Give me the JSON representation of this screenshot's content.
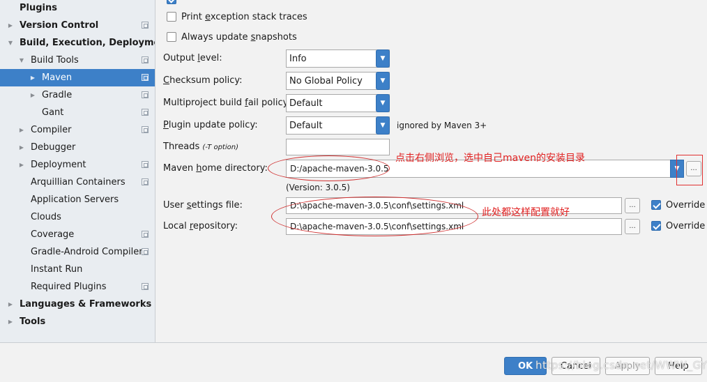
{
  "sidebar": {
    "items": [
      {
        "label": "Plugins",
        "bold": true,
        "level": 0,
        "arrow": "none",
        "icon": false,
        "selected": false
      },
      {
        "label": "Version Control",
        "bold": true,
        "level": 0,
        "arrow": "right",
        "icon": true,
        "selected": false
      },
      {
        "label": "Build, Execution, Deployment",
        "bold": true,
        "level": 0,
        "arrow": "down",
        "icon": false,
        "selected": false
      },
      {
        "label": "Build Tools",
        "bold": false,
        "level": 1,
        "arrow": "down",
        "icon": true,
        "selected": false
      },
      {
        "label": "Maven",
        "bold": false,
        "level": 2,
        "arrow": "right",
        "icon": true,
        "selected": true
      },
      {
        "label": "Gradle",
        "bold": false,
        "level": 2,
        "arrow": "right",
        "icon": true,
        "selected": false
      },
      {
        "label": "Gant",
        "bold": false,
        "level": 2,
        "arrow": "none",
        "icon": true,
        "selected": false
      },
      {
        "label": "Compiler",
        "bold": false,
        "level": 1,
        "arrow": "right",
        "icon": true,
        "selected": false
      },
      {
        "label": "Debugger",
        "bold": false,
        "level": 1,
        "arrow": "right",
        "icon": false,
        "selected": false
      },
      {
        "label": "Deployment",
        "bold": false,
        "level": 1,
        "arrow": "right",
        "icon": true,
        "selected": false
      },
      {
        "label": "Arquillian Containers",
        "bold": false,
        "level": 1,
        "arrow": "none",
        "icon": true,
        "selected": false
      },
      {
        "label": "Application Servers",
        "bold": false,
        "level": 1,
        "arrow": "none",
        "icon": false,
        "selected": false
      },
      {
        "label": "Clouds",
        "bold": false,
        "level": 1,
        "arrow": "none",
        "icon": false,
        "selected": false
      },
      {
        "label": "Coverage",
        "bold": false,
        "level": 1,
        "arrow": "none",
        "icon": true,
        "selected": false
      },
      {
        "label": "Gradle-Android Compiler",
        "bold": false,
        "level": 1,
        "arrow": "none",
        "icon": true,
        "selected": false
      },
      {
        "label": "Instant Run",
        "bold": false,
        "level": 1,
        "arrow": "none",
        "icon": false,
        "selected": false
      },
      {
        "label": "Required Plugins",
        "bold": false,
        "level": 1,
        "arrow": "none",
        "icon": true,
        "selected": false
      },
      {
        "label": "Languages & Frameworks",
        "bold": true,
        "level": 0,
        "arrow": "right",
        "icon": false,
        "selected": false
      },
      {
        "label": "Tools",
        "bold": true,
        "level": 0,
        "arrow": "right",
        "icon": false,
        "selected": false
      }
    ]
  },
  "form": {
    "print_exception": {
      "pre": "Print ",
      "mn": "e",
      "post": "xception stack traces",
      "checked": false
    },
    "always_update": {
      "pre": "Always update ",
      "mn": "s",
      "post": "napshots",
      "checked": false
    },
    "output_level": {
      "pre": "Output ",
      "mn": "l",
      "post": "evel:",
      "value": "Info"
    },
    "checksum_policy": {
      "pre": "",
      "mn": "C",
      "post": "hecksum policy:",
      "value": "No Global Policy"
    },
    "multiproject_policy": {
      "pre": "Multiproject build ",
      "mn": "f",
      "post": "ail policy:",
      "value": "Default"
    },
    "plugin_update_policy": {
      "pre": "",
      "mn": "P",
      "post": "lugin update policy:",
      "value": "Default",
      "hint": "ignored by Maven 3+"
    },
    "threads": {
      "label": "Threads",
      "hint": "(-T option)",
      "value": ""
    },
    "maven_home": {
      "pre": "Maven ",
      "mn": "h",
      "post": "ome directory:",
      "value": "D:/apache-maven-3.0.5",
      "version": "(Version: 3.0.5)"
    },
    "user_settings": {
      "pre": "User ",
      "mn": "s",
      "post": "ettings file:",
      "value": "D:\\apache-maven-3.0.5\\conf\\settings.xml",
      "override_label": "Override",
      "override_checked": true
    },
    "local_repo": {
      "pre": "Local ",
      "mn": "r",
      "post": "epository:",
      "value": "D:\\apache-maven-3.0.5\\conf\\settings.xml",
      "override_label": "Override",
      "override_checked": true
    },
    "browse_label": "..."
  },
  "annotations": {
    "note1": "点击右侧浏览，选中自己maven的安装目录",
    "note2": "此处都这样配置就好"
  },
  "buttons": {
    "ok": "OK",
    "cancel": "Cancel",
    "apply": "Apply",
    "help": "Help"
  },
  "watermark": "https://blog.csdn.net/WWW_GYR",
  "colors": {
    "accent": "#3d80c8",
    "annotation": "#e02020",
    "sidebar_bg": "#e9edf1"
  }
}
